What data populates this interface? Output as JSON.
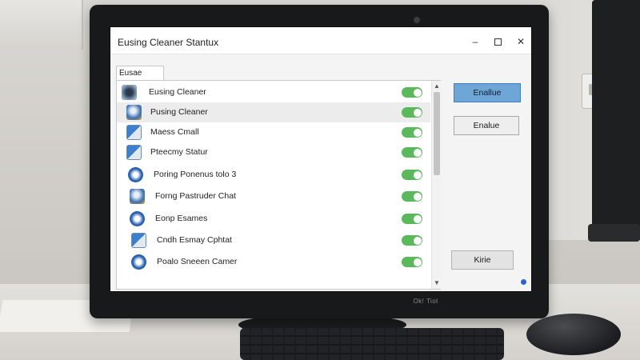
{
  "window": {
    "title": "Eusing Cleaner Stantux",
    "controls": {
      "minimize": "–",
      "close": "✕"
    }
  },
  "tab": {
    "label": "Eusae Cude"
  },
  "list": {
    "items": [
      {
        "label": "Eusing Cleaner",
        "icon": "cleaner-icon",
        "enabled": true
      },
      {
        "label": "Pusing Cleaner",
        "icon": "globe-icon",
        "enabled": true
      },
      {
        "label": "Maess Cmall",
        "icon": "window-icon",
        "enabled": true
      },
      {
        "label": "Pteecmy Statur",
        "icon": "window-icon",
        "enabled": true
      },
      {
        "label": "Poring Ponenus tolo  3",
        "icon": "browser-icon",
        "enabled": true
      },
      {
        "label": "Forng Pastruder Chat",
        "icon": "globe-icon",
        "enabled": true
      },
      {
        "label": "Eonp Esames",
        "icon": "browser-icon",
        "enabled": true
      },
      {
        "label": "Cndh Esmay Cphtat",
        "icon": "window-icon",
        "enabled": true
      },
      {
        "label": "Poalo Sneeen Camer",
        "icon": "browser-icon",
        "enabled": true
      }
    ],
    "toggle_on_color": "#5cb85c",
    "selected_row": 1
  },
  "scrollbar": {
    "up": "▲",
    "down": "▼"
  },
  "buttons": {
    "primary": "Enallue",
    "secondary": "Enalue",
    "tertiary": "Kirie"
  },
  "monitor": {
    "brand": "Ok! Tiol"
  },
  "colors": {
    "accent": "#6fa6d8",
    "accent_border": "#3d7fbf"
  }
}
